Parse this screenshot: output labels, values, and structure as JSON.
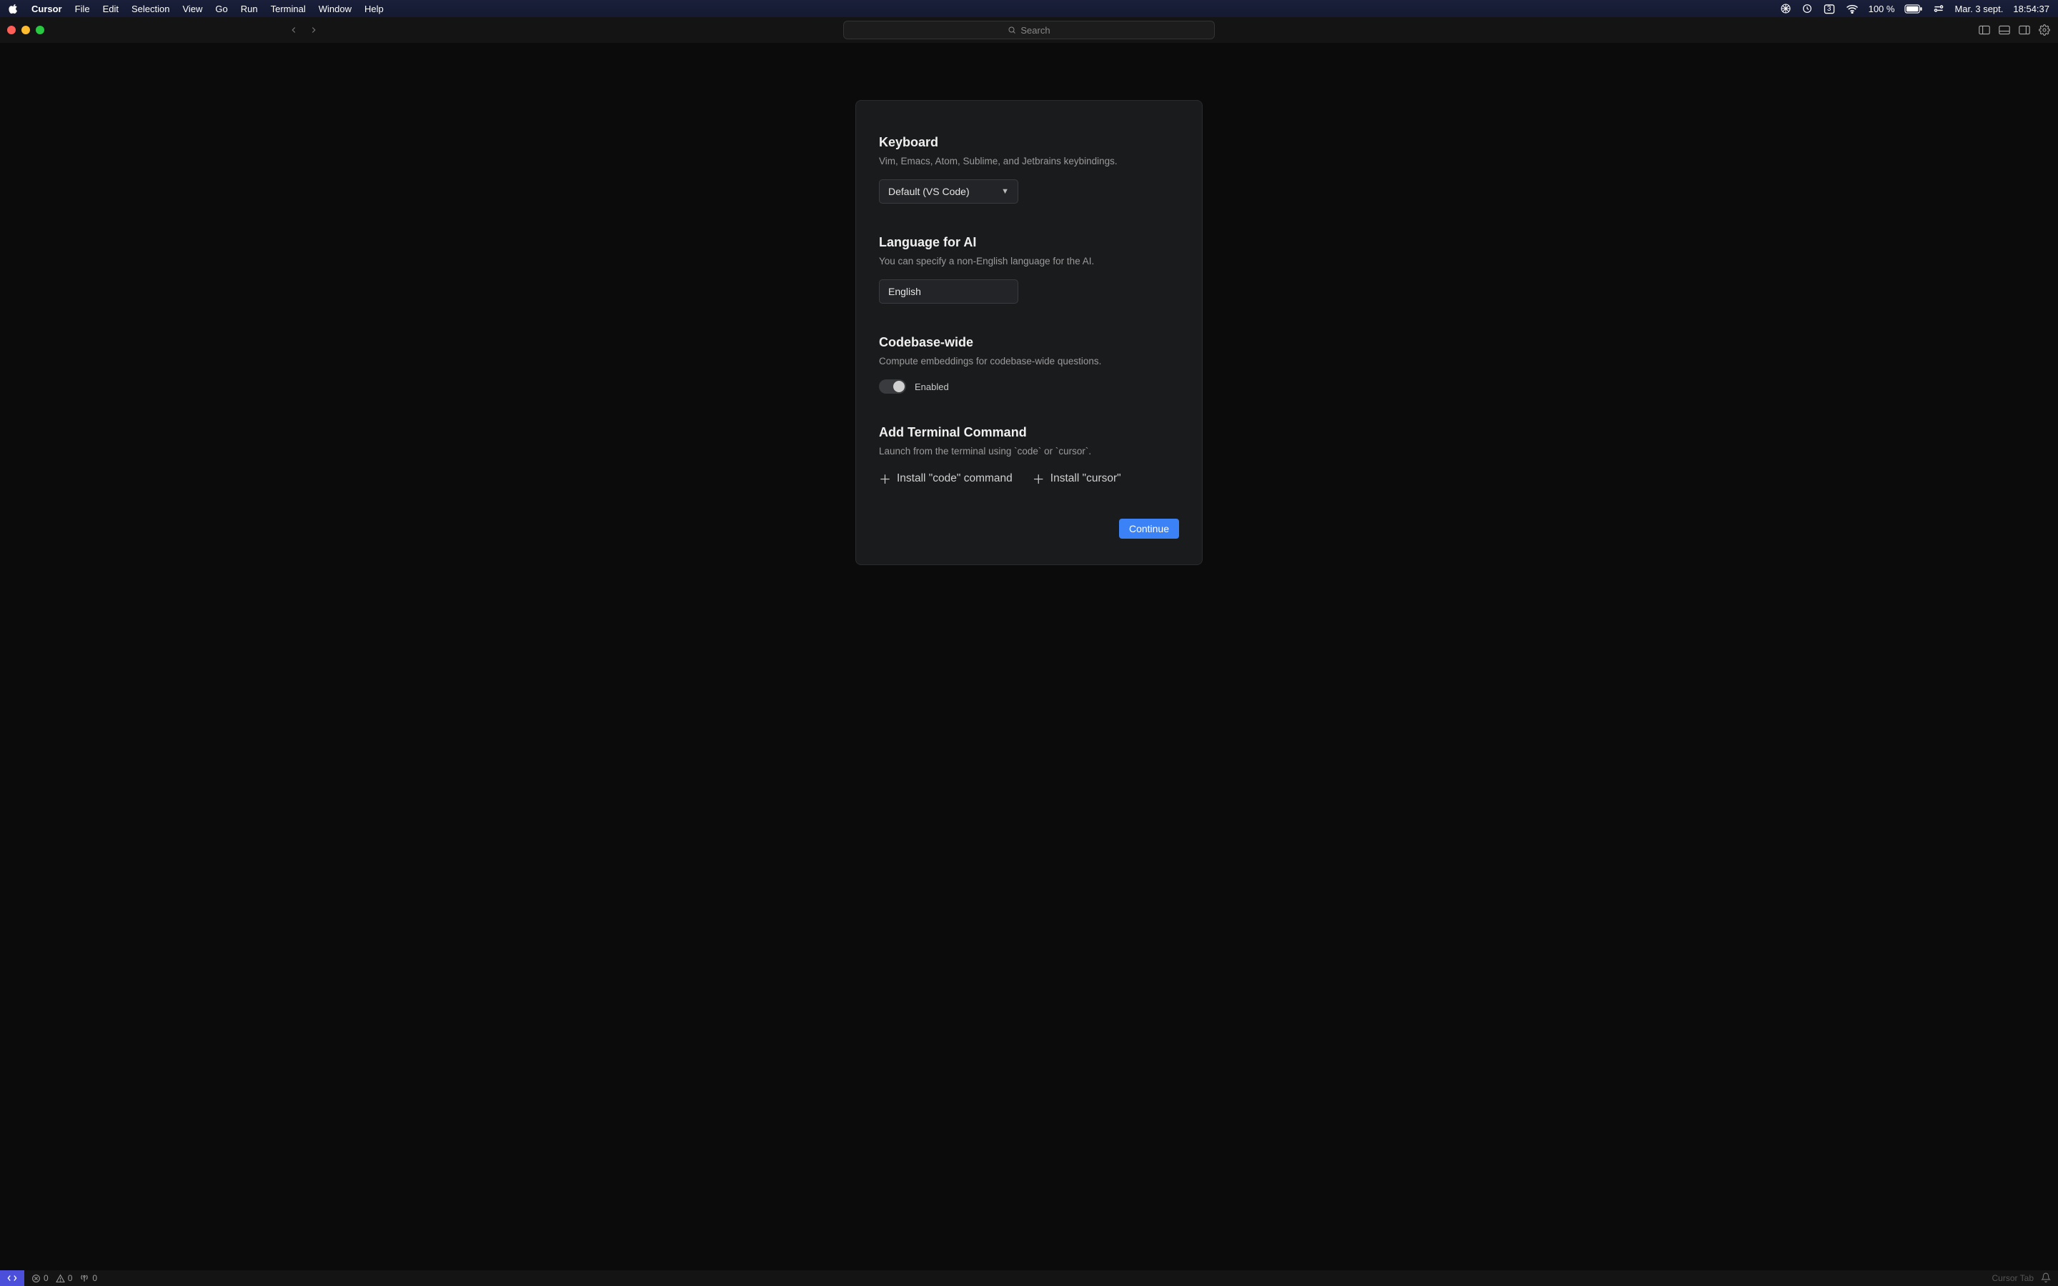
{
  "menubar": {
    "app_name": "Cursor",
    "items": [
      "File",
      "Edit",
      "Selection",
      "View",
      "Go",
      "Run",
      "Terminal",
      "Window",
      "Help"
    ],
    "battery_pct": "100 %",
    "date": "Mar. 3 sept.",
    "time": "18:54:37",
    "calendar_day": "3"
  },
  "titlebar": {
    "search_placeholder": "Search"
  },
  "setup": {
    "keyboard": {
      "title": "Keyboard",
      "desc": "Vim, Emacs, Atom, Sublime, and Jetbrains keybindings.",
      "selected": "Default (VS Code)"
    },
    "language": {
      "title": "Language for AI",
      "desc": "You can specify a non-English language for the AI.",
      "value": "English"
    },
    "codebase": {
      "title": "Codebase-wide",
      "desc": "Compute embeddings for codebase-wide questions.",
      "toggle_label": "Enabled",
      "toggle_on": true
    },
    "terminal": {
      "title": "Add Terminal Command",
      "desc": "Launch from the terminal using `code` or `cursor`.",
      "install_code": "Install \"code\" command",
      "install_cursor": "Install \"cursor\""
    },
    "continue_label": "Continue"
  },
  "statusbar": {
    "errors": "0",
    "warnings": "0",
    "ports": "0",
    "right_hint": "Cursor Tab"
  }
}
